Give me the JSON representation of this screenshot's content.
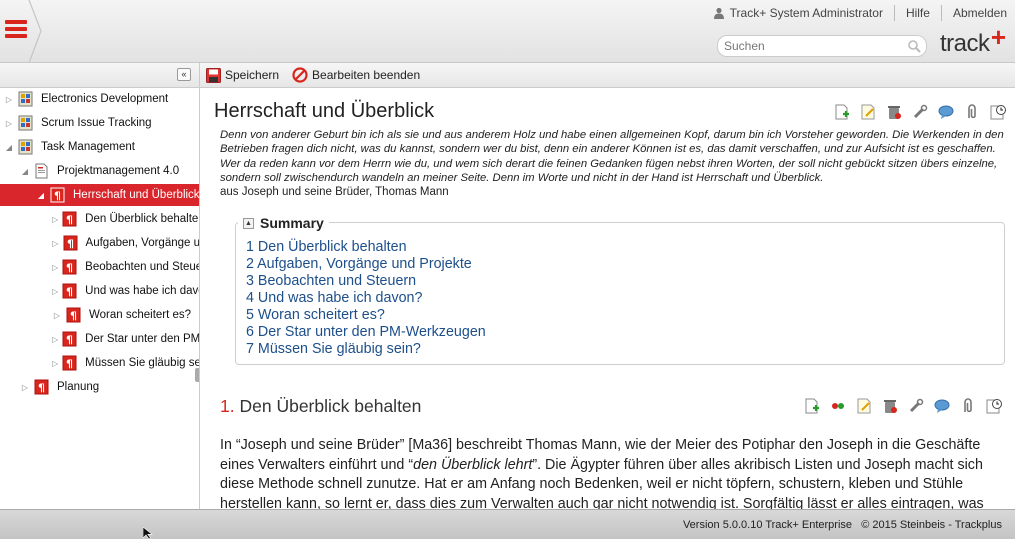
{
  "header": {
    "user_name": "Track+ System Administrator",
    "help_label": "Hilfe",
    "logout_label": "Abmelden",
    "search_placeholder": "Suchen",
    "logo_text": "track",
    "logo_plus": "+",
    "accent_color": "#d9261c"
  },
  "toolbar": {
    "save_label": "Speichern",
    "stop_edit_label": "Bearbeiten beenden",
    "collapse_glyph": "«"
  },
  "sidebar": {
    "items": [
      {
        "label": "Electronics Development",
        "icon": "project-icon"
      },
      {
        "label": "Scrum Issue Tracking",
        "icon": "project-icon"
      },
      {
        "label": "Task Management",
        "icon": "project-icon"
      },
      {
        "label": "Projektmanagement 4.0",
        "icon": "document-icon"
      },
      {
        "label": "Herrschaft und Überblick",
        "icon": "wiki-page-icon",
        "selected": true
      },
      {
        "label": "Den Überblick behalten",
        "icon": "wiki-page-icon"
      },
      {
        "label": "Aufgaben, Vorgänge u",
        "icon": "wiki-page-icon"
      },
      {
        "label": "Beobachten und Steuern",
        "icon": "wiki-page-icon"
      },
      {
        "label": "Und was habe ich davon?",
        "icon": "wiki-page-icon"
      },
      {
        "label": "Woran scheitert es?",
        "icon": "wiki-page-icon"
      },
      {
        "label": "Der Star unter den PM",
        "icon": "wiki-page-icon"
      },
      {
        "label": "Müssen Sie gläubig se",
        "icon": "wiki-page-icon"
      },
      {
        "label": "Planung",
        "icon": "wiki-page-icon"
      }
    ]
  },
  "content": {
    "title": "Herrschaft und Überblick",
    "quote": "Denn von anderer Geburt bin ich als sie und aus anderem Holz und habe einen allgemeinen Kopf, darum bin ich Vorsteher geworden. Die Werkenden in den Betrieben fragen dich nicht, was du kannst, sondern wer du bist, denn ein anderer Können ist es, das damit verschaffen, und zur Aufsicht ist es geschaffen. Wer da reden kann vor dem Herrn wie du, und wem sich derart die feinen Gedanken fügen nebst ihren Worten, der soll nicht gebückt sitzen übers einzelne, sondern soll zwischendurch wandeln an meiner Seite. Denn im Worte und nicht in der Hand ist Herrschaft und Überblick.",
    "quote_source": "aus Joseph und seine Brüder, Thomas Mann",
    "summary": {
      "toggle_glyph": "▲",
      "title": "Summary",
      "items": [
        "1 Den Überblick behalten",
        "2 Aufgaben, Vorgänge und Projekte",
        "3 Beobachten und Steuern",
        "4 Und was habe ich davon?",
        "5 Woran scheitert es?",
        "6 Der Star unter den PM-Werkzeugen",
        "7 Müssen Sie gläubig sein?"
      ]
    },
    "section": {
      "number": "1.",
      "title": "Den Überblick behalten",
      "p1": "In “Joseph und seine Brüder” [Ma36] beschreibt Thomas Mann, wie der Meier des Potiphar den Joseph in die Geschäfte eines Verwalters einführt und “",
      "p1_em": "den Überblick lehrt",
      "p1_end": "”. Die Ägypter führen über alles akribisch Listen und Joseph macht sich diese Methode schnell zunutze. Hat er am Anfang noch Bedenken, weil er nicht töpfern, schustern, kleben und Stühle herstellen kann, so lernt er, dass dies zum Verwalten auch gar nicht notwendig ist. Sorgfältig lässt er alles eintragen, was"
    }
  },
  "footer": {
    "version": "Version 5.0.0.10 Track+ Enterprise",
    "copyright": "© 2015 Steinbeis - Trackplus"
  }
}
